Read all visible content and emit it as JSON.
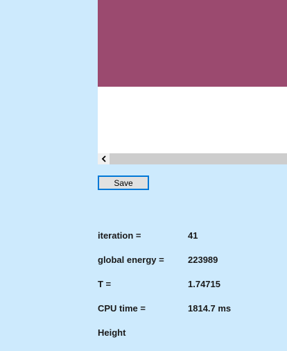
{
  "colors": {
    "background": "#cdeafd",
    "render_fill": "#9b4a6f",
    "save_border": "#0078d7"
  },
  "save_button": {
    "label": "Save"
  },
  "scrollbar": {
    "left_arrow_icon": "chevron-left-icon",
    "left_arrow_glyph": "<"
  },
  "stats": {
    "iteration": {
      "label": "iteration =",
      "value": "41"
    },
    "global_energy": {
      "label": "global energy =",
      "value": "223989"
    },
    "temperature": {
      "label": "T =",
      "value": "1.74715"
    },
    "cpu_time": {
      "label": "CPU time =",
      "value": "1814.7 ms"
    },
    "height": {
      "label": "Height"
    }
  }
}
